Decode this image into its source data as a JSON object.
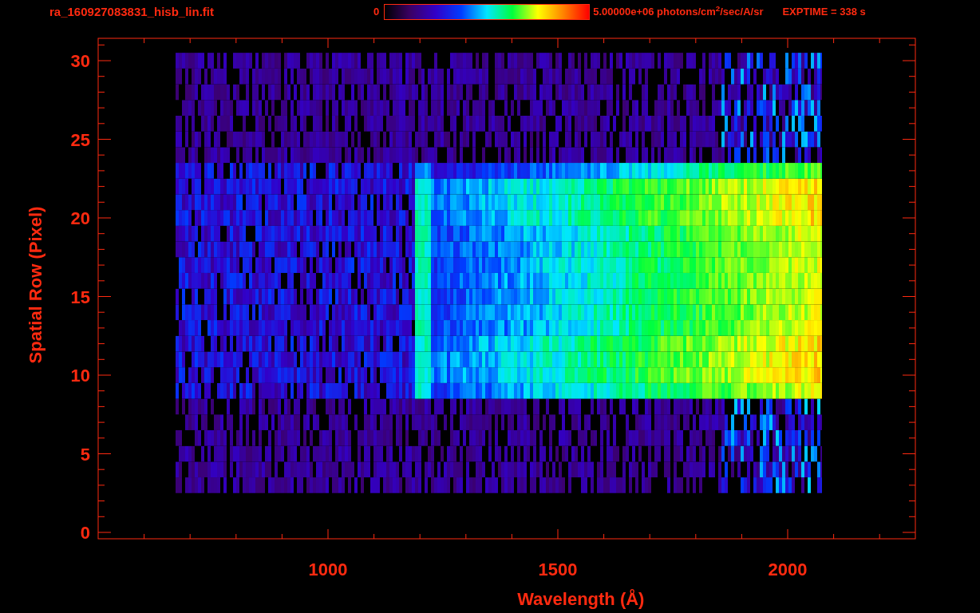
{
  "title": "ra_160927083831_hisb_lin.fit",
  "colorbar": {
    "min_label": "0",
    "max_label": "5.00000e+06 photons/cm$^{2}$/sec/A/sr"
  },
  "exptime": "EXPTIME = 338 s",
  "plot": {
    "xlabel": "Wavelength (Å)",
    "ylabel": "Spatial Row (Pixel)",
    "xticks": [
      "1000",
      "1500",
      "2000"
    ],
    "yticks": [
      "30",
      "25",
      "20",
      "15",
      "10",
      "5",
      "0"
    ]
  }
}
